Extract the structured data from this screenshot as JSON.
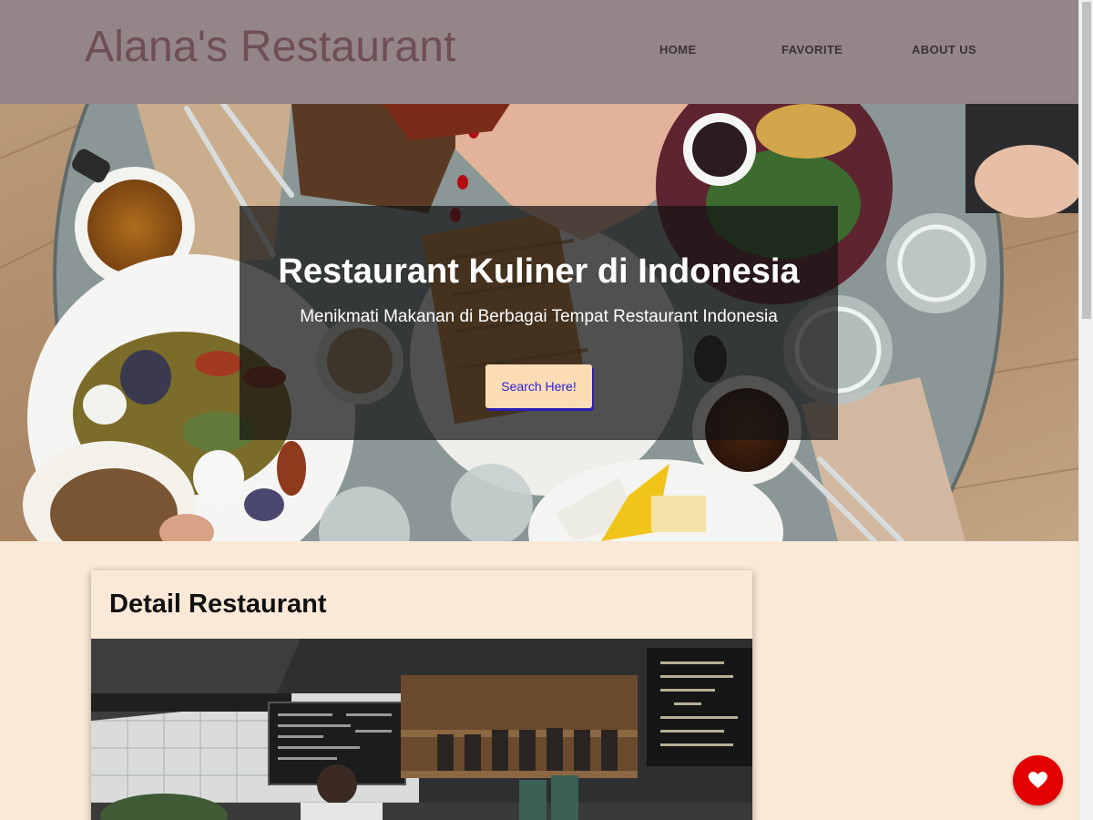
{
  "header": {
    "brand": "Alana's Restaurant",
    "nav": [
      {
        "label": "HOME"
      },
      {
        "label": "FAVORITE"
      },
      {
        "label": "ABOUT US"
      }
    ]
  },
  "hero": {
    "title": "Restaurant Kuliner di Indonesia",
    "subtitle": "Menikmati Makanan di Berbagai Tempat Restaurant Indonesia",
    "button_label": "Search Here!"
  },
  "detail": {
    "title": "Detail Restaurant"
  },
  "favorite_button": {
    "icon": "heart-icon",
    "color": "#e30000"
  },
  "colors": {
    "header_bg": "#948688",
    "brand_text": "#6f4e55",
    "page_bg": "#fbe9d7",
    "button_bg": "#fbdcb5",
    "button_text": "#2a1fe0"
  }
}
